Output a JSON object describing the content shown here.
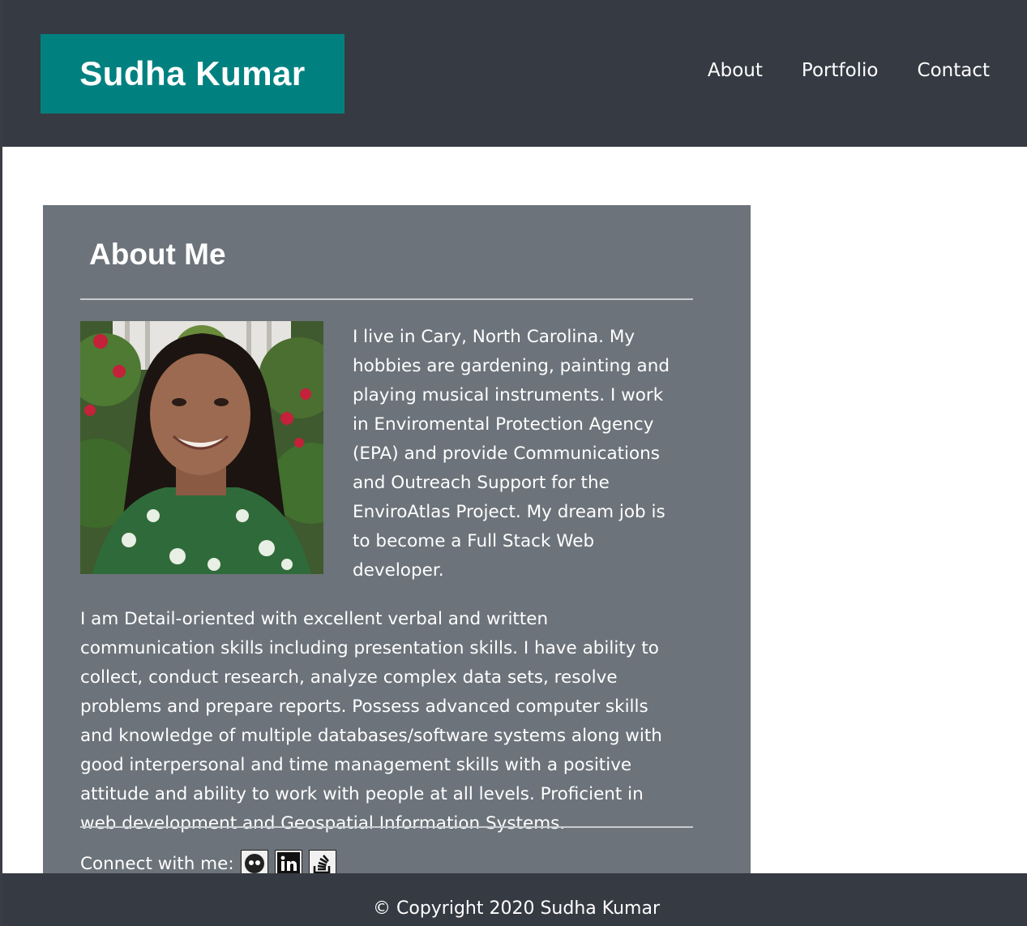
{
  "header": {
    "brand": "Sudha Kumar",
    "nav": [
      "About",
      "Portfolio",
      "Contact"
    ]
  },
  "about": {
    "title": "About Me",
    "paragraph1": "I live in Cary, North Carolina. My hobbies are gardening, painting and playing musical instruments. I work in Enviromental Protection Agency (EPA) and provide Communications and Outreach Support for the EnviroAtlas Project. My dream job is to become a Full Stack Web developer.",
    "paragraph2": "I am Detail-oriented with excellent verbal and written communication skills including presentation skills. I have ability to collect, conduct research, analyze complex data sets, resolve problems and prepare reports. Possess advanced computer skills and knowledge of multiple databases/software systems along with good interpersonal and time management skills with a positive attitude and ability to work with people at all levels. Proficient in web development and Geospatial Information Systems.",
    "connect_label": "Connect with me:",
    "social_icons": [
      "github-icon",
      "linkedin-icon",
      "stackoverflow-icon"
    ]
  },
  "footer": {
    "copyright": "© Copyright 2020 Sudha Kumar"
  },
  "colors": {
    "header_bg": "#363a42",
    "brand_bg": "#00817f",
    "card_bg": "#6c737a",
    "text": "#ffffff"
  }
}
